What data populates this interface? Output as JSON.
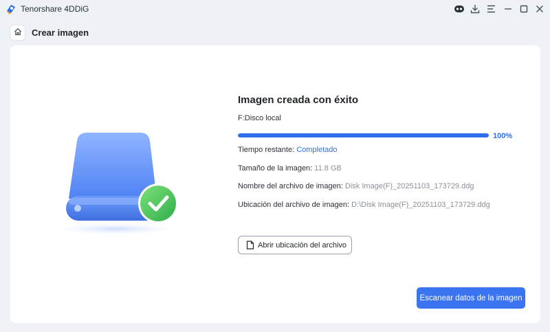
{
  "window": {
    "app_title": "Tenorshare 4DDiG",
    "icons": [
      "chatbot-icon",
      "download-icon",
      "menu-icon",
      "minimize-icon",
      "maximize-icon",
      "close-icon"
    ]
  },
  "header": {
    "home_icon": "home-icon",
    "title": "Crear imagen"
  },
  "result": {
    "title": "Imagen creada con éxito",
    "disk": "F:Disco local",
    "progress_percent": 100,
    "progress_label": "100%",
    "time_label": "Tiempo restante:",
    "time_value": "Completado",
    "size_label": "Tamaño de la imagen:",
    "size_value": "11.8 GB",
    "filename_label": "Nombre del archivo de imagen:",
    "filename_value": "Disk Image(F)_20251103_173729.ddg",
    "location_label": "Ubicación del archivo de imagen:",
    "location_value": "D:\\Disk Image(F)_20251103_173729.ddg"
  },
  "actions": {
    "open_location": "Abrir ubicación del archivo",
    "scan": "Escanear datos de la imagen"
  },
  "colors": {
    "accent": "#2f6fee",
    "success": "#39b84f",
    "background": "#eef1f6"
  }
}
